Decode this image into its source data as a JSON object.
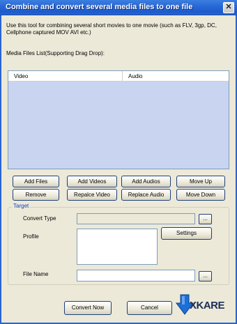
{
  "window": {
    "title": "Combine and convert several media files to one file",
    "close_glyph": "✕"
  },
  "description": "Use this tool for combining several short movies to one movie (such as FLV, 3gp, DC, Cellphone captured MOV AVI etc.)",
  "list": {
    "label": "Media Files List(Supporting Drag  Drop):",
    "columns": [
      "Video",
      "Audio"
    ]
  },
  "buttons": {
    "add_files": "Add Files",
    "add_videos": "Add Videos",
    "add_audios": "Add Audios",
    "move_up": "Move Up",
    "remove": "Remove",
    "replace_video": "Repalce Video",
    "replace_audio": "Replace Audio",
    "move_down": "Move Down"
  },
  "target": {
    "legend": "Target",
    "convert_type_label": "Convert Type",
    "convert_type_value": "",
    "profile_label": "Profile",
    "profile_value": "",
    "settings_button": "Settings",
    "file_name_label": "File Name",
    "file_name_value": "",
    "browse_glyph": "..."
  },
  "footer": {
    "convert_now": "Convert Now",
    "cancel": "Cancel",
    "logo_text": "XKARE"
  },
  "colors": {
    "titlebar": "#2a6ad8",
    "list_background": "#c8d4f0",
    "legend_text": "#1540c0",
    "dialog_background": "#ece9d8"
  }
}
